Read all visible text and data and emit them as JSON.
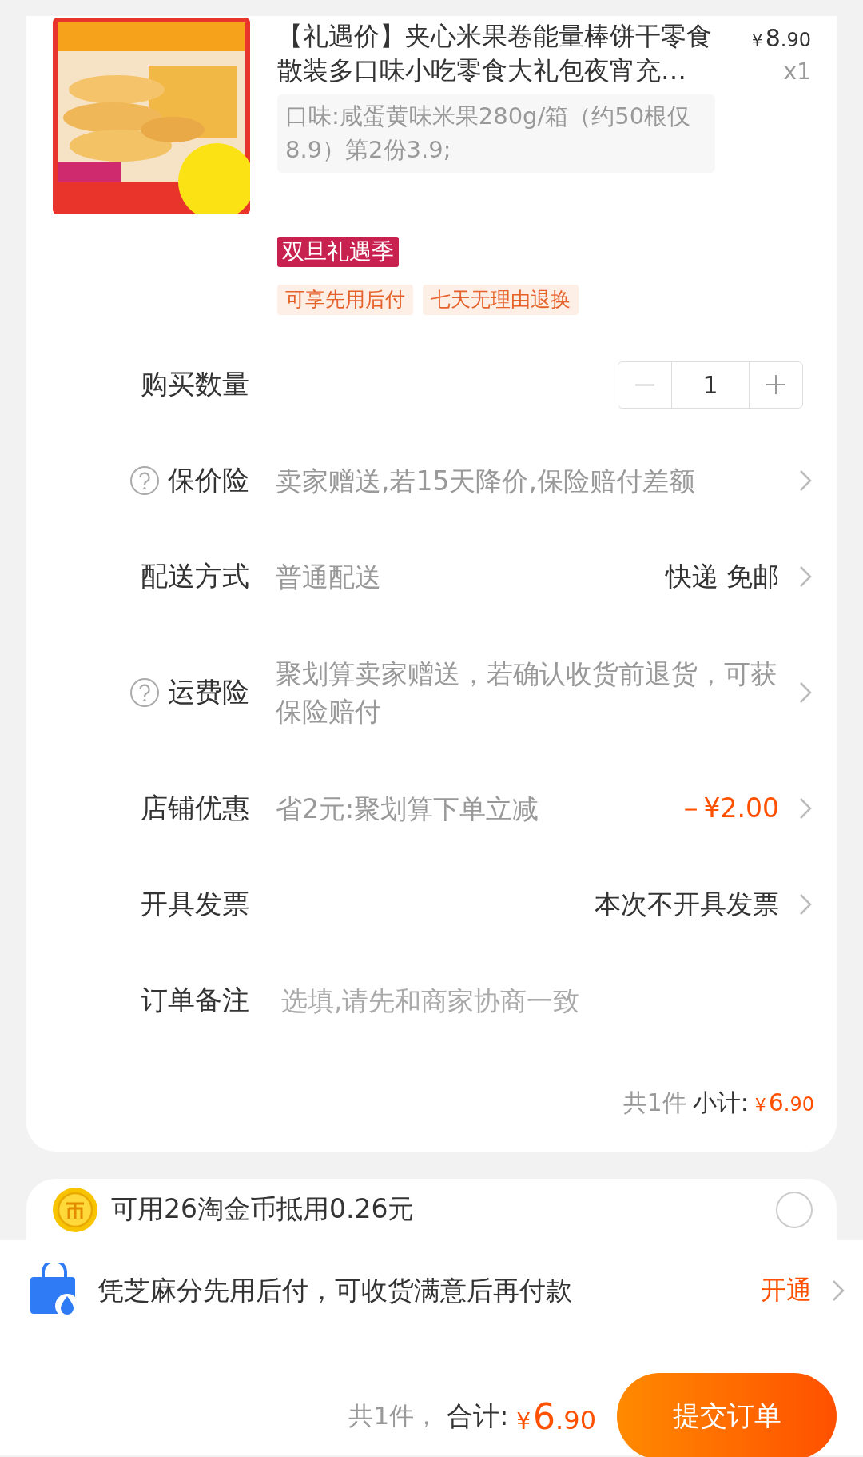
{
  "product": {
    "title": "【礼遇价】夹心米果卷能量棒饼干零食散装多口味小吃零食大礼包夜宵充…",
    "price": {
      "symbol": "¥",
      "int": "8",
      "dec": ".90"
    },
    "quantity": "x1",
    "spec": "口味:咸蛋黄味米果280g/箱（约50根仅8.9）第2份3.9;",
    "promo_tag": "双旦礼遇季",
    "service_tags": [
      "可享先用后付",
      "七天无理由退换"
    ]
  },
  "rows": [
    {
      "kind": "stepper",
      "label": "购买数量",
      "value": "1"
    },
    {
      "kind": "info",
      "help": true,
      "label": "保价险",
      "desc": "卖家赠送,若15天降价,保险赔付差额"
    },
    {
      "kind": "info",
      "help": false,
      "label": "配送方式",
      "desc": "普通配送",
      "value": "快递 免邮",
      "highlight": false
    },
    {
      "kind": "info",
      "help": true,
      "label": "运费险",
      "desc": "聚划算卖家赠送，若确认收货前退货，可获保险赔付"
    },
    {
      "kind": "info",
      "help": false,
      "label": "店铺优惠",
      "desc": "省2元:聚划算下单立减",
      "value": "－¥2.00",
      "highlight": true
    },
    {
      "kind": "info",
      "help": false,
      "label": "开具发票",
      "value": "本次不开具发票",
      "highlight": false
    },
    {
      "kind": "note",
      "label": "订单备注",
      "placeholder": "选填,请先和商家协商一致"
    }
  ],
  "subtotal": {
    "count": "共1件",
    "label": "小计:",
    "price": {
      "symbol": "¥",
      "int": "6",
      "dec": ".90"
    }
  },
  "coins": {
    "text": "可用26淘金币抵用0.26元",
    "selected": false
  },
  "credit": {
    "text": "凭芝麻分先用后付，可收货满意后再付款",
    "action": "开通"
  },
  "footer": {
    "count": "共1件，",
    "label": "合计:",
    "price": {
      "symbol": "¥",
      "int": "6",
      "dec": ".90"
    },
    "button": "提交订单"
  }
}
